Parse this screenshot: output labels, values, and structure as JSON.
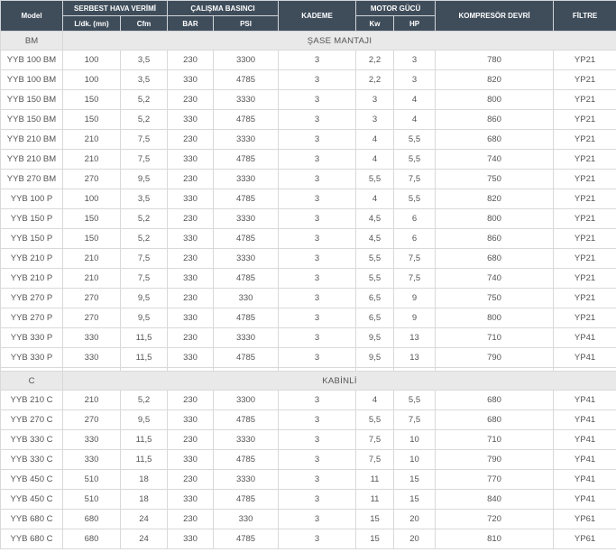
{
  "headers": {
    "model": "Model",
    "serbest": "SERBEST HAVA VERİMİ",
    "ldk": "L/dk. (mn)",
    "cfm": "Cfm",
    "calisma": "ÇALIŞMA BASINCI",
    "bar": "BAR",
    "psi": "PSI",
    "kademe": "KADEME",
    "motor": "MOTOR GÜCÜ",
    "kw": "Kw",
    "hp": "HP",
    "kompresor": "KOMPRESÖR DEVRİ",
    "filtre": "FİLTRE"
  },
  "sections": [
    {
      "code": "BM",
      "label": "ŞASE MANTAJI",
      "rows": [
        [
          "YYB 100 BM",
          "100",
          "3,5",
          "230",
          "3300",
          "3",
          "2,2",
          "3",
          "780",
          "YP21"
        ],
        [
          "YYB 100 BM",
          "100",
          "3,5",
          "330",
          "4785",
          "3",
          "2,2",
          "3",
          "820",
          "YP21"
        ],
        [
          "YYB 150 BM",
          "150",
          "5,2",
          "230",
          "3330",
          "3",
          "3",
          "4",
          "800",
          "YP21"
        ],
        [
          "YYB 150 BM",
          "150",
          "5,2",
          "330",
          "4785",
          "3",
          "3",
          "4",
          "860",
          "YP21"
        ],
        [
          "YYB 210 BM",
          "210",
          "7,5",
          "230",
          "3330",
          "3",
          "4",
          "5,5",
          "680",
          "YP21"
        ],
        [
          "YYB 210 BM",
          "210",
          "7,5",
          "330",
          "4785",
          "3",
          "4",
          "5,5",
          "740",
          "YP21"
        ],
        [
          "YYB 270 BM",
          "270",
          "9,5",
          "230",
          "3330",
          "3",
          "5,5",
          "7,5",
          "750",
          "YP21"
        ],
        [
          "YYB 100 P",
          "100",
          "3,5",
          "330",
          "4785",
          "3",
          "4",
          "5,5",
          "820",
          "YP21"
        ],
        [
          "YYB 150 P",
          "150",
          "5,2",
          "230",
          "3330",
          "3",
          "4,5",
          "6",
          "800",
          "YP21"
        ],
        [
          "YYB 150 P",
          "150",
          "5,2",
          "330",
          "4785",
          "3",
          "4,5",
          "6",
          "860",
          "YP21"
        ],
        [
          "YYB 210 P",
          "210",
          "7,5",
          "230",
          "3330",
          "3",
          "5,5",
          "7,5",
          "680",
          "YP21"
        ],
        [
          "YYB 210 P",
          "210",
          "7,5",
          "330",
          "4785",
          "3",
          "5,5",
          "7,5",
          "740",
          "YP21"
        ],
        [
          "YYB 270 P",
          "270",
          "9,5",
          "230",
          "330",
          "3",
          "6,5",
          "9",
          "750",
          "YP21"
        ],
        [
          "YYB 270 P",
          "270",
          "9,5",
          "330",
          "4785",
          "3",
          "6,5",
          "9",
          "800",
          "YP21"
        ],
        [
          "YYB 330 P",
          "330",
          "11,5",
          "230",
          "3330",
          "3",
          "9,5",
          "13",
          "710",
          "YP41"
        ],
        [
          "YYB 330 P",
          "330",
          "11,5",
          "330",
          "4785",
          "3",
          "9,5",
          "13",
          "790",
          "YP41"
        ]
      ]
    },
    {
      "code": "C",
      "label": "KABİNLİ",
      "rows": [
        [
          "YYB 210 C",
          "210",
          "5,2",
          "230",
          "3300",
          "3",
          "4",
          "5,5",
          "680",
          "YP41"
        ],
        [
          "YYB 270 C",
          "270",
          "9,5",
          "330",
          "4785",
          "3",
          "5,5",
          "7,5",
          "680",
          "YP41"
        ],
        [
          "YYB 330 C",
          "330",
          "11,5",
          "230",
          "3330",
          "3",
          "7,5",
          "10",
          "710",
          "YP41"
        ],
        [
          "YYB 330 C",
          "330",
          "11,5",
          "330",
          "4785",
          "3",
          "7,5",
          "10",
          "790",
          "YP41"
        ],
        [
          "YYB 450 C",
          "510",
          "18",
          "230",
          "3330",
          "3",
          "11",
          "15",
          "770",
          "YP41"
        ],
        [
          "YYB 450 C",
          "510",
          "18",
          "330",
          "4785",
          "3",
          "11",
          "15",
          "840",
          "YP41"
        ],
        [
          "YYB 680 C",
          "680",
          "24",
          "230",
          "330",
          "3",
          "15",
          "20",
          "720",
          "YP61"
        ],
        [
          "YYB 680 C",
          "680",
          "24",
          "330",
          "4785",
          "3",
          "15",
          "20",
          "810",
          "YP61"
        ]
      ]
    }
  ]
}
